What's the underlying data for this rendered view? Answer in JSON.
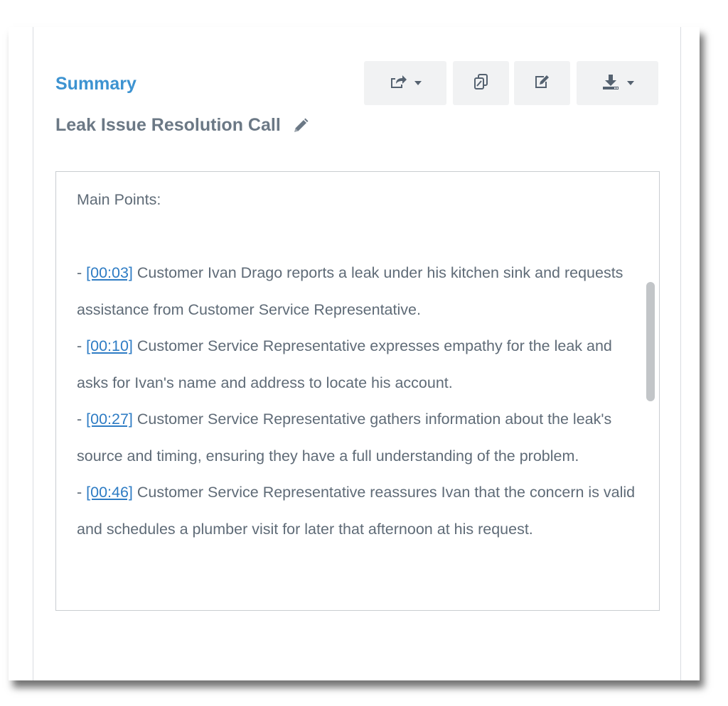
{
  "panel": {
    "section_label": "Summary",
    "call_title": "Leak Issue Resolution Call"
  },
  "toolbar": {
    "buttons": [
      {
        "name": "share-button",
        "icon": "share-icon",
        "has_dropdown": true
      },
      {
        "name": "copy-button",
        "icon": "copy-icon",
        "has_dropdown": false
      },
      {
        "name": "edit-button",
        "icon": "edit-icon",
        "has_dropdown": false
      },
      {
        "name": "download-button",
        "icon": "download-icon",
        "has_dropdown": true
      }
    ]
  },
  "summary": {
    "heading": "Main Points:",
    "points": [
      {
        "prefix": "- ",
        "timestamp": "[00:03]",
        "text": " Customer Ivan Drago reports a leak under his kitchen sink and requests assistance from Customer Service Representative."
      },
      {
        "prefix": "- ",
        "timestamp": "[00:10]",
        "text": " Customer Service Representative expresses empathy for the leak and asks for Ivan's name and address to locate his account."
      },
      {
        "prefix": "- ",
        "timestamp": "[00:27]",
        "text": " Customer Service Representative gathers information about the leak's source and timing, ensuring they have a full understanding of the problem."
      },
      {
        "prefix": "- ",
        "timestamp": "[00:46]",
        "text": " Customer Service Representative reassures Ivan that the concern is valid and schedules a plumber visit for later that afternoon at his request."
      }
    ]
  },
  "colors": {
    "accent": "#3d93d1",
    "title": "#6b7885",
    "body_text": "#5f6b77",
    "link": "#2e7cc4",
    "button_bg": "#f1f2f3"
  }
}
